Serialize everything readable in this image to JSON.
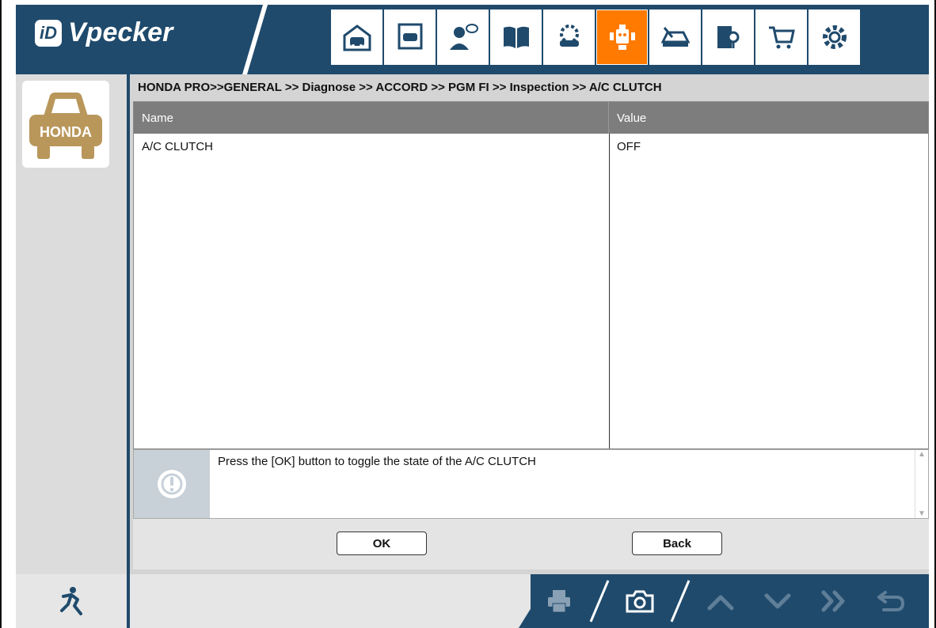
{
  "app": {
    "brand_name": "Vpecker",
    "brand_mark": "iD"
  },
  "toolbar_icons": [
    {
      "name": "home-garage-icon",
      "active": false
    },
    {
      "name": "vehicle-window-icon",
      "active": false
    },
    {
      "name": "user-chat-icon",
      "active": false
    },
    {
      "name": "book-icon",
      "active": false
    },
    {
      "name": "gear-car-icon",
      "active": false
    },
    {
      "name": "robot-diagnose-icon",
      "active": true
    },
    {
      "name": "car-repair-icon",
      "active": false
    },
    {
      "name": "manual-search-icon",
      "active": false
    },
    {
      "name": "shopping-cart-icon",
      "active": false
    },
    {
      "name": "settings-gear-icon",
      "active": false
    }
  ],
  "vehicle_badge": {
    "label": "HONDA"
  },
  "breadcrumb": "HONDA PRO>>GENERAL >> Diagnose >> ACCORD >> PGM FI >> Inspection >> A/C CLUTCH",
  "table": {
    "columns": [
      "Name",
      "Value"
    ],
    "rows": [
      {
        "name": "A/C CLUTCH",
        "value": "OFF"
      }
    ]
  },
  "message": {
    "text": "Press the [OK] button to toggle the state of the A/C CLUTCH"
  },
  "buttons": {
    "ok_label": "OK",
    "back_label": "Back"
  },
  "colors": {
    "brand_blue": "#1f4a6c",
    "active_orange": "#ff7a00",
    "honda_gold": "#b9975b"
  }
}
